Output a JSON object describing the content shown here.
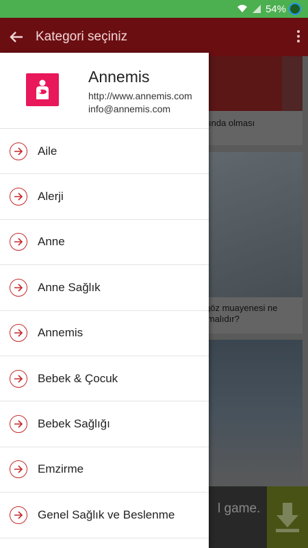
{
  "status_bar": {
    "battery": "54%"
  },
  "app_bar": {
    "title": "Kategori seçiniz"
  },
  "background_cards": [
    {
      "text": "ında olması"
    },
    {
      "text_line1": "göz muayenesi ne",
      "text_line2": "lmalıdır?"
    }
  ],
  "ad": {
    "text": "l game."
  },
  "drawer": {
    "brand_name": "Annemis",
    "url": "http://www.annemis.com",
    "email": "info@annemis.com",
    "items": [
      {
        "label": "Aile"
      },
      {
        "label": "Alerji"
      },
      {
        "label": "Anne"
      },
      {
        "label": "Anne Sağlık"
      },
      {
        "label": "Annemis"
      },
      {
        "label": "Bebek & Çocuk"
      },
      {
        "label": "Bebek Sağlığı"
      },
      {
        "label": "Emzirme"
      },
      {
        "label": "Genel Sağlık ve Beslenme"
      }
    ]
  },
  "colors": {
    "status_bar": "#4caf50",
    "app_bar": "#8b1a1f",
    "accent": "#c62828",
    "logo": "#e8185a"
  }
}
